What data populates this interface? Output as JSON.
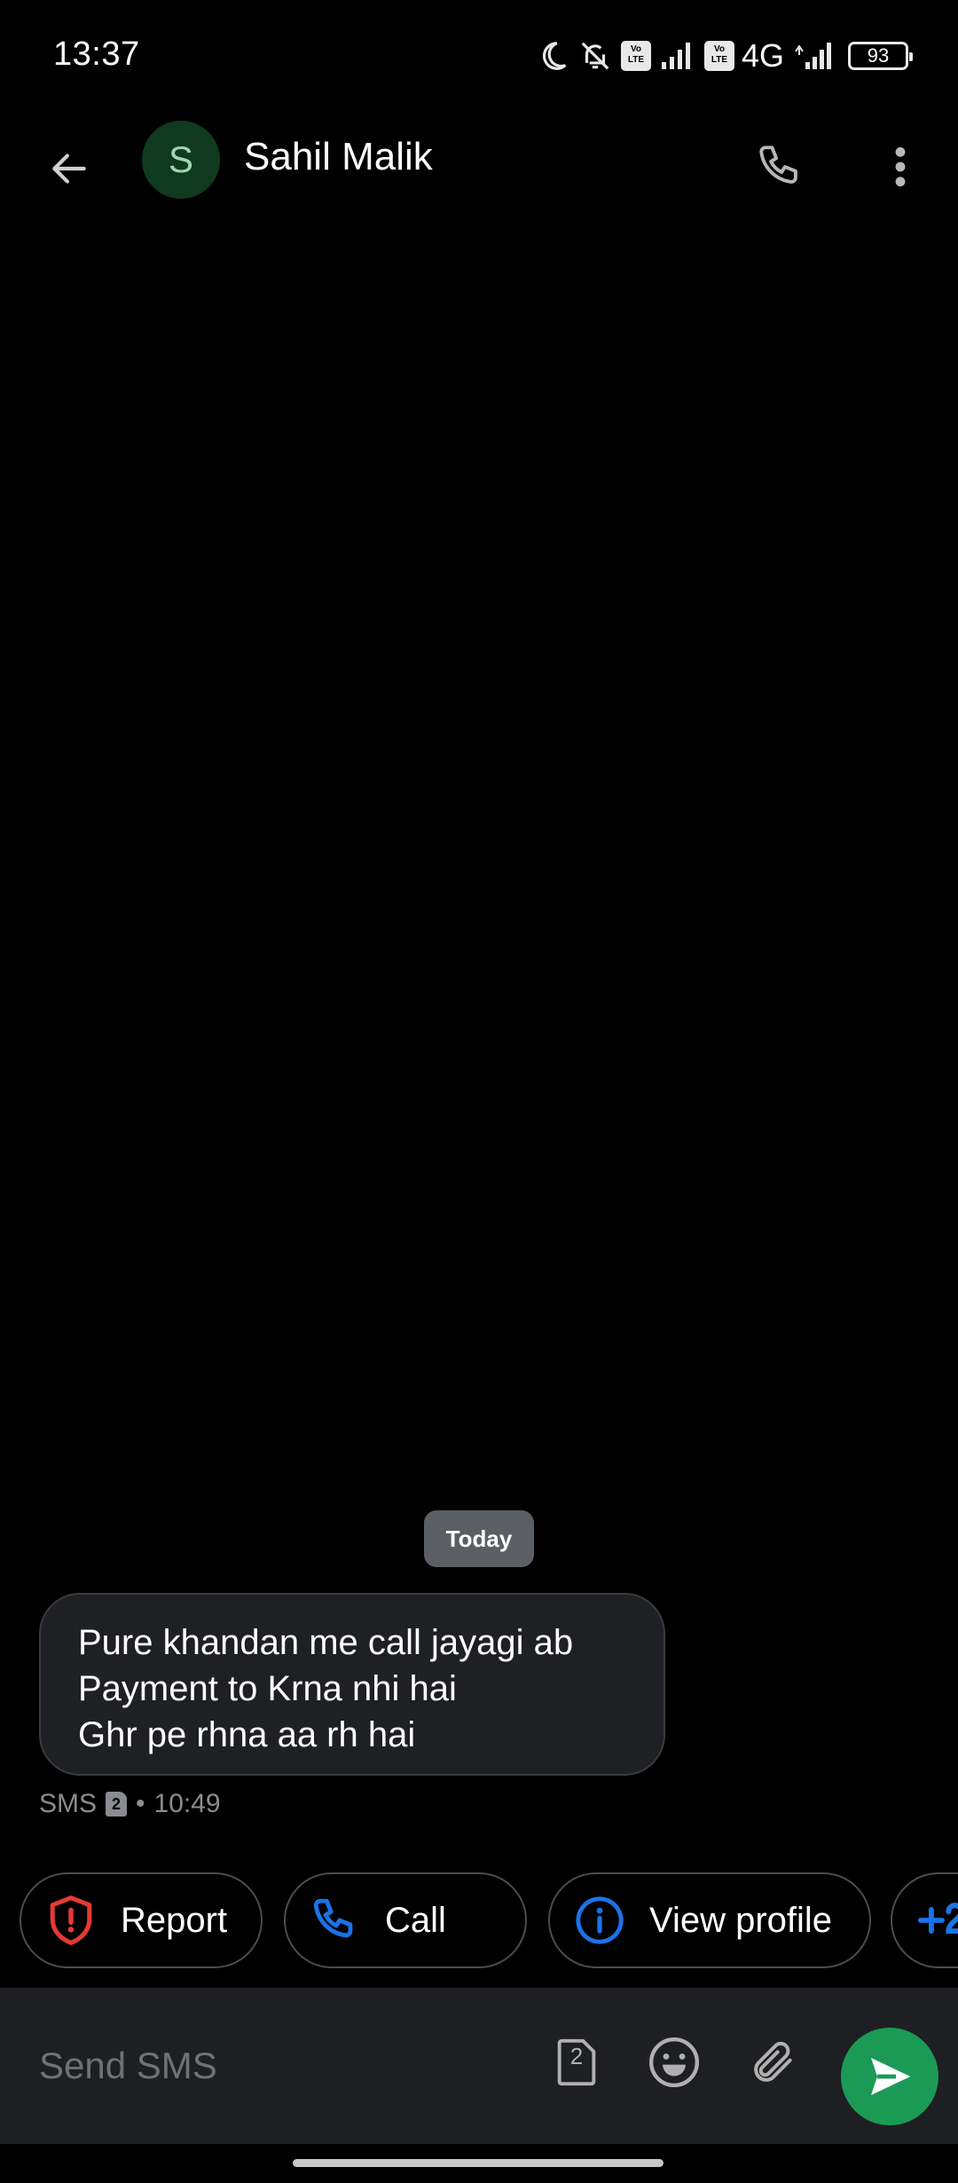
{
  "status_bar": {
    "time": "13:37",
    "network": "4G",
    "battery": "93"
  },
  "header": {
    "avatar_letter": "S",
    "contact_name": "Sahil Malik"
  },
  "conversation": {
    "date_chip": "Today",
    "message": {
      "lines": [
        "Pure khandan me call jayagi ab",
        "Payment to Krna nhi hai",
        "Ghr pe rhna aa rh hai"
      ],
      "type": "SMS",
      "sim": "2",
      "separator": "•",
      "time": "10:49"
    }
  },
  "suggestions": [
    {
      "label": "Report",
      "icon": "shield-alert-icon"
    },
    {
      "label": "Call",
      "icon": "phone-icon"
    },
    {
      "label": "View profile",
      "icon": "info-icon"
    },
    {
      "label": "",
      "icon": "add-contact-icon"
    }
  ],
  "composer": {
    "placeholder": "Send SMS",
    "sim_number": "2"
  },
  "colors": {
    "background": "#000000",
    "bubble": "#1f2023",
    "accent_green": "#1b9a55",
    "report_red": "#e53935",
    "action_blue": "#1a73e8",
    "avatar_bg": "#0f3a1f"
  }
}
